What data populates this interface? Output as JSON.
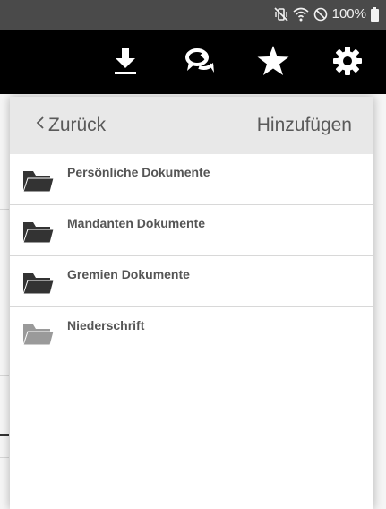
{
  "status_bar": {
    "battery_percent": "100%",
    "icons": [
      "mute-vibrate-icon",
      "wifi-icon",
      "do-not-disturb-icon",
      "battery-icon"
    ]
  },
  "header": {
    "actions": [
      {
        "name": "download-icon"
      },
      {
        "name": "chat-icon"
      },
      {
        "name": "star-icon"
      },
      {
        "name": "gear-icon"
      }
    ],
    "background": "#000000"
  },
  "popover": {
    "back_label": "Zurück",
    "add_label": "Hinzufügen",
    "folders": [
      {
        "label": "Persönliche Dokumente",
        "icon_color": "#333333"
      },
      {
        "label": "Mandanten Dokumente",
        "icon_color": "#333333"
      },
      {
        "label": "Gremien Dokumente",
        "icon_color": "#333333"
      },
      {
        "label": "Niederschrift",
        "icon_color": "#9a9a9a"
      }
    ]
  }
}
